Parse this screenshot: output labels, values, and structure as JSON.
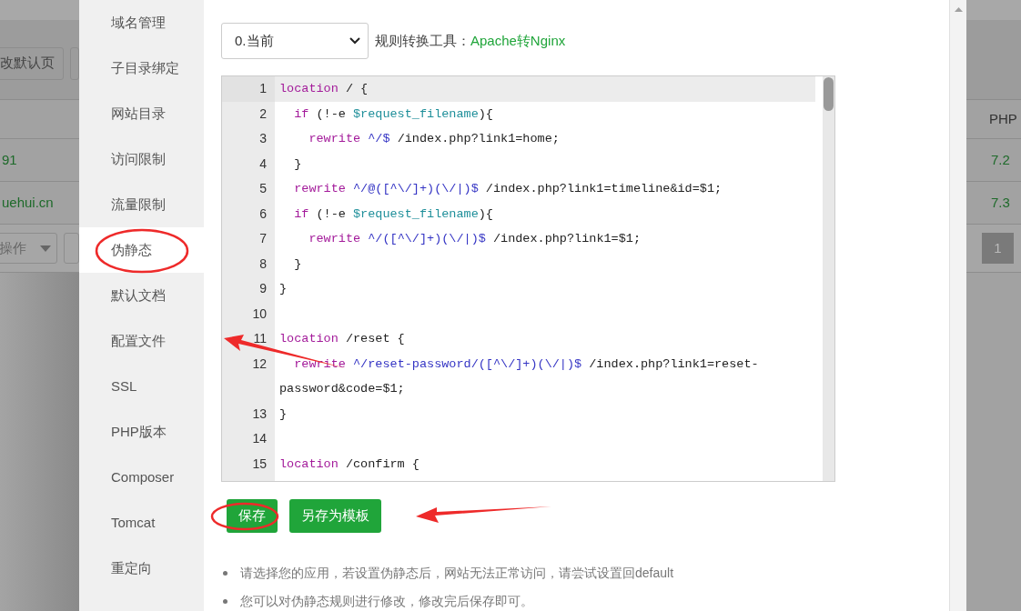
{
  "background_page": {
    "left": {
      "button": "改默认页",
      "rows": [
        "91",
        "uehui.cn"
      ],
      "bulk_select": "操作"
    },
    "right": {
      "column_header": "PHP",
      "rows": [
        "7.2",
        "7.3"
      ],
      "page": "1"
    }
  },
  "sidebar": {
    "items": [
      {
        "label": "域名管理",
        "selected": false
      },
      {
        "label": "子目录绑定",
        "selected": false
      },
      {
        "label": "网站目录",
        "selected": false
      },
      {
        "label": "访问限制",
        "selected": false
      },
      {
        "label": "流量限制",
        "selected": false
      },
      {
        "label": "伪静态",
        "selected": true
      },
      {
        "label": "默认文档",
        "selected": false
      },
      {
        "label": "配置文件",
        "selected": false
      },
      {
        "label": "SSL",
        "selected": false
      },
      {
        "label": "PHP版本",
        "selected": false
      },
      {
        "label": "Composer",
        "selected": false
      },
      {
        "label": "Tomcat",
        "selected": false
      },
      {
        "label": "重定向",
        "selected": false
      }
    ]
  },
  "rewrite_select": {
    "value": "0.当前"
  },
  "converter": {
    "label": "规则转换工具：",
    "link": "Apache转Nginx"
  },
  "editor": {
    "lines": [
      {
        "number": "1",
        "active": true,
        "tokens": [
          {
            "kind": "keyword",
            "text": "location"
          },
          {
            "kind": "plain",
            "text": " / {"
          }
        ]
      },
      {
        "number": "2",
        "active": false,
        "tokens": [
          {
            "kind": "keyword",
            "text": "  if"
          },
          {
            "kind": "plain",
            "text": " (!-e "
          },
          {
            "kind": "variable",
            "text": "$request_filename"
          },
          {
            "kind": "plain",
            "text": "){"
          }
        ]
      },
      {
        "number": "3",
        "active": false,
        "tokens": [
          {
            "kind": "keyword",
            "text": "    rewrite"
          },
          {
            "kind": "regex",
            "text": " ^/$"
          },
          {
            "kind": "plain",
            "text": " /index.php?link1=home;"
          }
        ]
      },
      {
        "number": "4",
        "active": false,
        "tokens": [
          {
            "kind": "plain",
            "text": "  }"
          }
        ]
      },
      {
        "number": "5",
        "active": false,
        "tokens": [
          {
            "kind": "keyword",
            "text": "  rewrite"
          },
          {
            "kind": "regex",
            "text": " ^/@([^\\/]+)(\\/|)$"
          },
          {
            "kind": "plain",
            "text": " /index.php?link1=timeline&id=$1;"
          }
        ]
      },
      {
        "number": "6",
        "active": false,
        "tokens": [
          {
            "kind": "keyword",
            "text": "  if"
          },
          {
            "kind": "plain",
            "text": " (!-e "
          },
          {
            "kind": "variable",
            "text": "$request_filename"
          },
          {
            "kind": "plain",
            "text": "){"
          }
        ]
      },
      {
        "number": "7",
        "active": false,
        "tokens": [
          {
            "kind": "keyword",
            "text": "    rewrite"
          },
          {
            "kind": "regex",
            "text": " ^/([^\\/]+)(\\/|)$"
          },
          {
            "kind": "plain",
            "text": " /index.php?link1=$1;"
          }
        ]
      },
      {
        "number": "8",
        "active": false,
        "tokens": [
          {
            "kind": "plain",
            "text": "  }"
          }
        ]
      },
      {
        "number": "9",
        "active": false,
        "tokens": [
          {
            "kind": "plain",
            "text": "}"
          }
        ]
      },
      {
        "number": "10",
        "active": false
      },
      {
        "number": "11",
        "active": false,
        "tokens": [
          {
            "kind": "keyword",
            "text": "location"
          },
          {
            "kind": "plain",
            "text": " /reset {"
          }
        ]
      },
      {
        "number": "12",
        "active": false,
        "tokens": [
          {
            "kind": "keyword",
            "text": "  rewrite"
          },
          {
            "kind": "regex",
            "text": " ^/reset-password/([^\\/]+)(\\/|)$"
          },
          {
            "kind": "plain",
            "text": " /index.php?link1=reset-password&code=$1;"
          }
        ]
      },
      {
        "number": "13",
        "active": false,
        "tokens": [
          {
            "kind": "plain",
            "text": "}"
          }
        ]
      },
      {
        "number": "14",
        "active": false
      },
      {
        "number": "15",
        "active": false,
        "tokens": [
          {
            "kind": "keyword",
            "text": "location"
          },
          {
            "kind": "plain",
            "text": " /confirm {"
          }
        ]
      }
    ]
  },
  "buttons": [
    {
      "label": "保存"
    },
    {
      "label": "另存为模板"
    }
  ],
  "tips": [
    "请选择您的应用，若设置伪静态后，网站无法正常访问，请尝试设置回default",
    "您可以对伪静态规则进行修改，修改完后保存即可。"
  ]
}
